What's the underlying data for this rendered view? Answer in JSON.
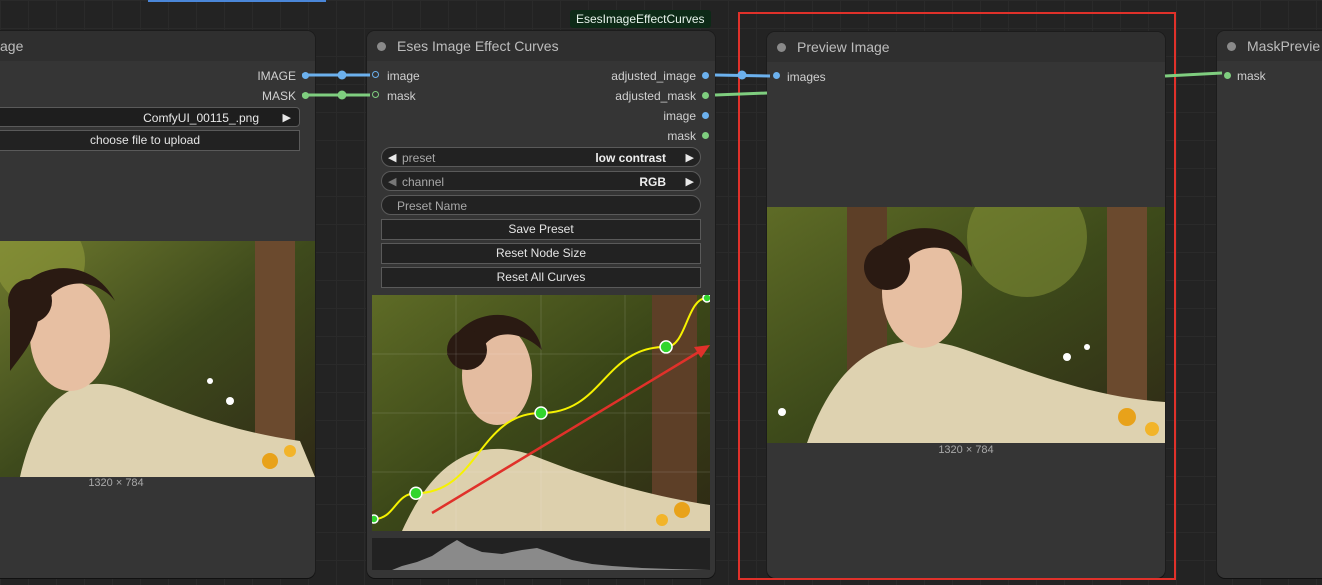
{
  "load_node": {
    "title_partial": "age",
    "outputs": [
      "IMAGE",
      "MASK"
    ],
    "file_value": "ComfyUI_00115_.png",
    "upload_label": "choose file to upload",
    "image_size": "1320 × 784"
  },
  "curves_node": {
    "badge": "EsesImageEffectCurves",
    "title": "Eses Image Effect Curves",
    "inputs": [
      "image",
      "mask"
    ],
    "outputs": [
      "adjusted_image",
      "adjusted_mask",
      "image",
      "mask"
    ],
    "preset_label": "preset",
    "preset_value": "low contrast",
    "channel_label": "channel",
    "channel_value": "RGB",
    "preset_name_placeholder": "Preset Name",
    "buttons": {
      "save": "Save Preset",
      "reset_size": "Reset Node Size",
      "reset_curves": "Reset All Curves"
    },
    "curve_points_normalized": [
      [
        0.0,
        0.0
      ],
      [
        0.13,
        0.16
      ],
      [
        0.5,
        0.5
      ],
      [
        0.87,
        0.78
      ],
      [
        1.0,
        1.0
      ]
    ]
  },
  "preview_node": {
    "title": "Preview Image",
    "input": "images",
    "image_size": "1320 × 784"
  },
  "mask_node": {
    "title_partial": "MaskPrevie",
    "input": "mask"
  },
  "colors": {
    "image_wire": "#6cb1ee",
    "mask_wire": "#7fce7f",
    "highlight": "#e0312a",
    "curve": "#f6f200",
    "curve_point": "#31d52d"
  }
}
